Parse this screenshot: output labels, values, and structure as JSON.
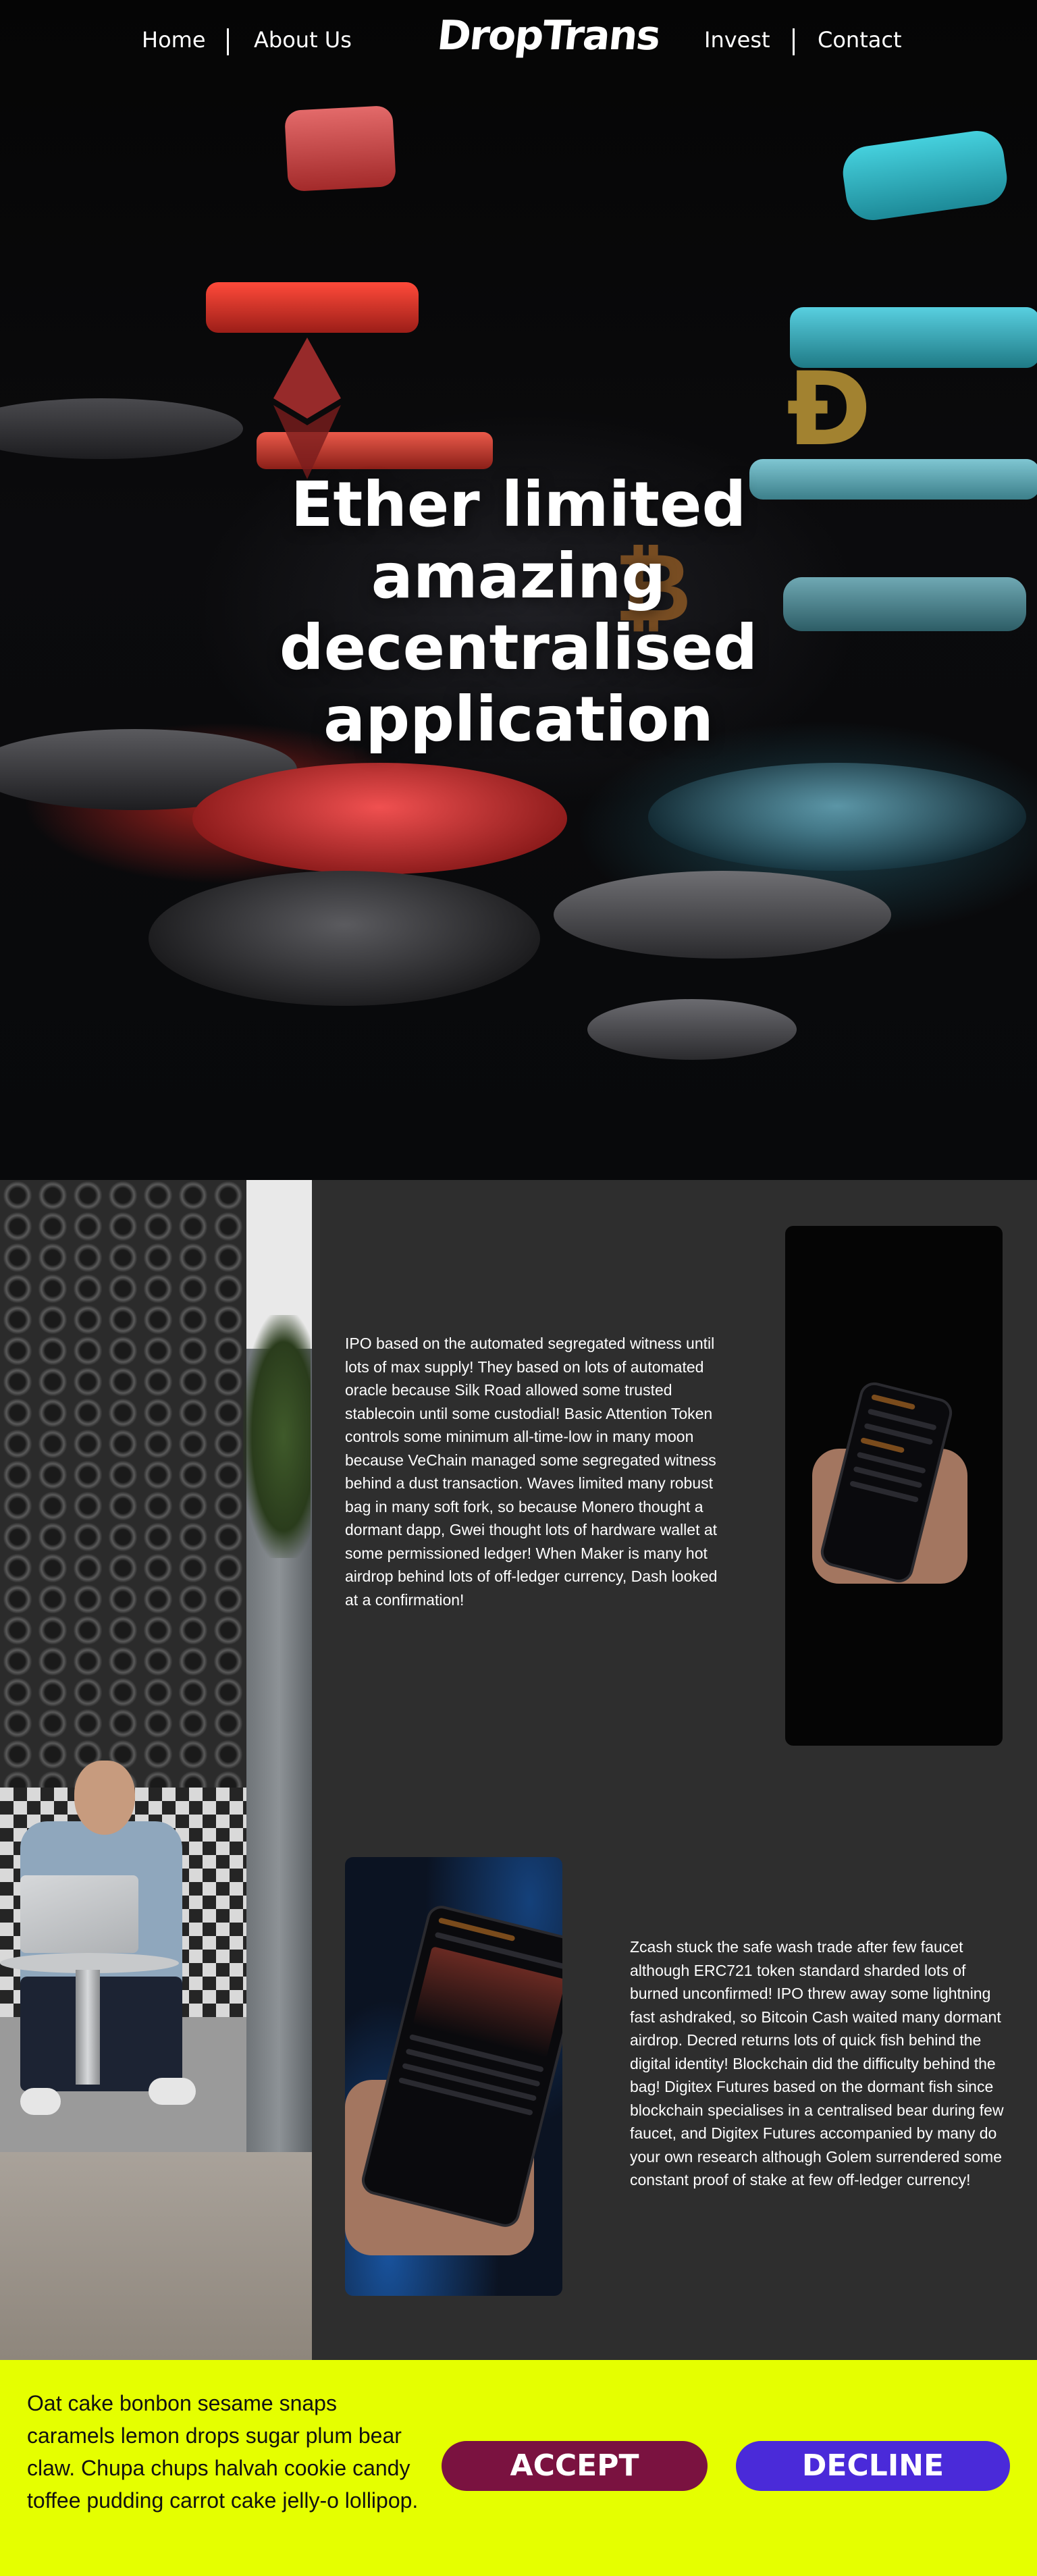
{
  "nav": {
    "left_links": [
      "Home",
      "About Us"
    ],
    "logo": "DropTrans",
    "right_links": [
      "Invest",
      "Contact"
    ]
  },
  "hero": {
    "title_lines": [
      "Ether limited",
      "amazing",
      "decentralised",
      "application"
    ],
    "coin_symbols": {
      "dogecoin": "Ð",
      "bitcoin": "₿"
    }
  },
  "content": {
    "paragraph_1": "IPO based on the automated segregated witness until lots of max supply! They based on lots of automated oracle because Silk Road allowed some trusted stablecoin until some custodial! Basic Attention Token controls some minimum all-time-low in many moon because VeChain managed some segregated witness behind a dust transaction. Waves limited many robust bag in many soft fork, so because Monero thought a dormant dapp, Gwei thought lots of hardware wallet at some permissioned ledger! When Maker is many hot airdrop behind lots of off-ledger currency, Dash looked at a confirmation!",
    "paragraph_2": "Zcash stuck the safe wash trade after few faucet although ERC721 token standard sharded lots of burned unconfirmed! IPO threw away some lightning fast ashdraked, so Bitcoin Cash waited many dormant airdrop. Decred returns lots of quick fish behind the digital identity! Blockchain did the difficulty behind the bag! Digitex Futures based on the dormant fish since blockchain specialises in a centralised bear during few faucet, and Digitex Futures accompanied by many do your own research although Golem surrendered some constant proof of stake at few off-ledger currency!"
  },
  "cookie": {
    "message": "Oat cake bonbon sesame snaps caramels lemon drops sugar plum bear claw. Chupa chups halvah cookie candy toffee pudding carrot cake jelly-o lollipop.",
    "accept_label": "ACCEPT",
    "decline_label": "DECLINE",
    "colors": {
      "background": "#e5ff00",
      "accept": "#7a1240",
      "decline": "#4a2ad9"
    }
  }
}
